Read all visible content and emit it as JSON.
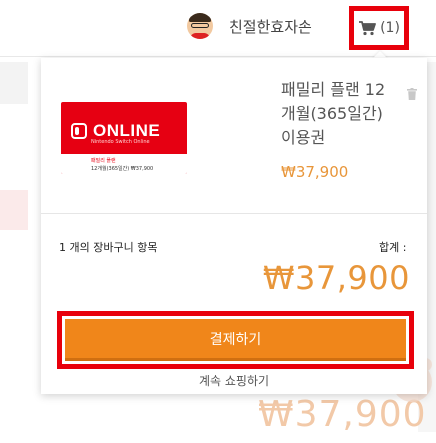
{
  "header": {
    "username": "친절한효자손",
    "cart_count": "(1)"
  },
  "cart": {
    "product": {
      "name": "패밀리 플랜 12 개월(365일간) 이용권",
      "price": "₩37,900",
      "image": {
        "logo_text": "ONLINE",
        "sub_text": "Nintendo Switch Online",
        "band_title": "패밀리 플랜",
        "band_price": "12개월(365일간) ₩37,900"
      }
    },
    "items_count": "1 개의 장바구니 항목",
    "total_label": "합계 :",
    "total_price": "₩37,900",
    "checkout_label": "결제하기",
    "continue_label": "계속 쇼핑하기"
  },
  "background": {
    "price_peek": "₩37,900"
  },
  "colors": {
    "accent": "#f0861a",
    "price": "#e8963a",
    "highlight": "#e8000b",
    "nintendo_red": "#e60012"
  },
  "icons": [
    "cart-icon",
    "trash-icon",
    "avatar"
  ]
}
